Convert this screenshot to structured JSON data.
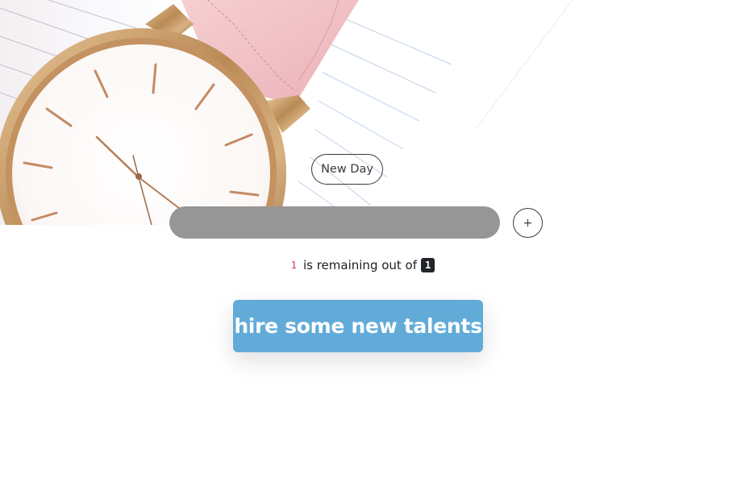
{
  "hero": {
    "image_description_icon": "wristwatch-icon",
    "colors": {
      "strap": "#f4c6c9",
      "gold": "#c99a63",
      "face": "#ffffff",
      "paper_lines": "#b9cde8"
    }
  },
  "new_day_button": {
    "label": "New Day"
  },
  "task_input": {
    "value": "",
    "placeholder": ""
  },
  "add_button": {
    "label": "+"
  },
  "remaining": {
    "count": "1",
    "text": "is remaining out of",
    "total": "1"
  },
  "hire_button": {
    "label": "hire some new talents"
  },
  "colors": {
    "input_bg": "#969696",
    "hire_bg": "#62abd9",
    "badge_bg": "#212529",
    "count_color": "#d6336c"
  }
}
